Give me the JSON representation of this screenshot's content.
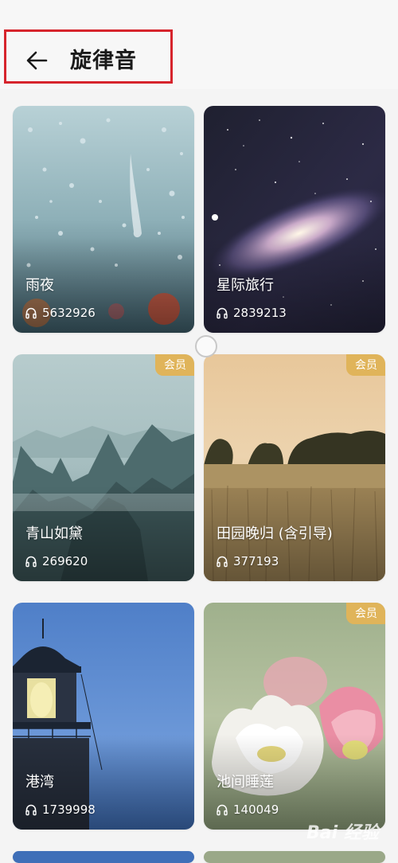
{
  "header": {
    "title": "旋律音",
    "back_icon": "arrow-left-icon"
  },
  "colors": {
    "badge": "#e0b45a",
    "highlight_box": "#d6242c",
    "background": "#f4f4f4"
  },
  "tracks": [
    {
      "title": "雨夜",
      "plays": "5632926",
      "badge": ""
    },
    {
      "title": "星际旅行",
      "plays": "2839213",
      "badge": ""
    },
    {
      "title": "青山如黛",
      "plays": "269620",
      "badge": "会员"
    },
    {
      "title": "田园晚归 (含引导)",
      "plays": "377193",
      "badge": "会员"
    },
    {
      "title": "港湾",
      "plays": "1739998",
      "badge": ""
    },
    {
      "title": "池间睡莲",
      "plays": "140049",
      "badge": "会员"
    }
  ],
  "watermark": "Bai 经验"
}
